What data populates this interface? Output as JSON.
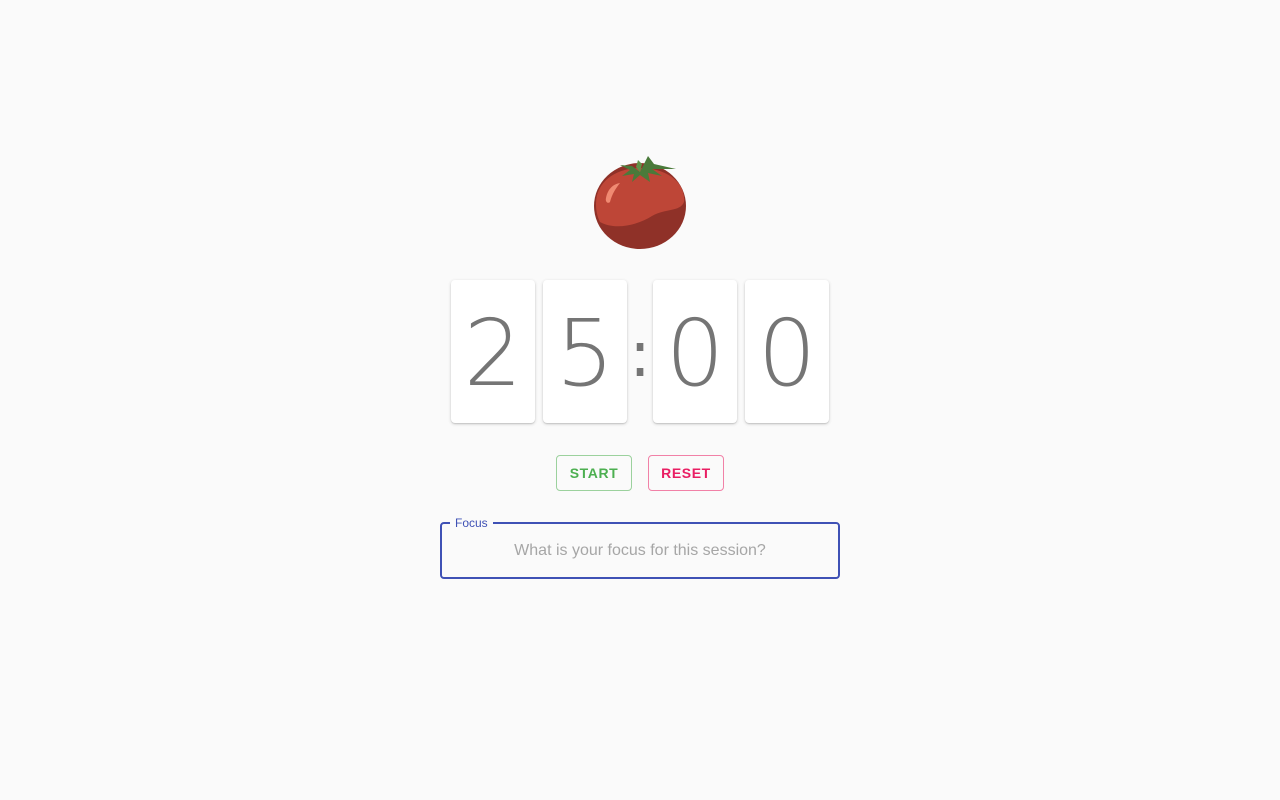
{
  "timer": {
    "minutes_tens": "2",
    "minutes_ones": "5",
    "separator": ":",
    "seconds_tens": "0",
    "seconds_ones": "0"
  },
  "controls": {
    "start_label": "START",
    "reset_label": "RESET"
  },
  "focus": {
    "label": "Focus",
    "placeholder": "What is your focus for this session?",
    "value": ""
  },
  "icons": {
    "logo": "tomato-icon"
  },
  "colors": {
    "background": "#fafafa",
    "digit_text": "#757575",
    "start": "#4caf50",
    "reset": "#e91e63",
    "focus_outline": "#3f51b5",
    "tomato_red": "#c0453a",
    "tomato_leaf": "#4a7a3a"
  }
}
